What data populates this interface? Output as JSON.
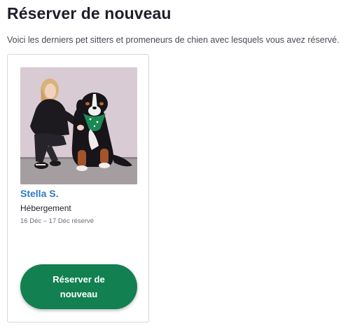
{
  "header": {
    "title": "Réserver de nouveau",
    "subtitle": "Voici les derniers pet sitters et promeneurs de chien avec lesquels vous avez réservé."
  },
  "sitters": [
    {
      "name": "Stella S.",
      "service": "Hébergement",
      "dates": "16 Déc – 17 Déc réservé",
      "button_label": "Réserver de nouveau"
    }
  ],
  "colors": {
    "accent_green": "#128051",
    "link_blue": "#2a7cc7"
  }
}
